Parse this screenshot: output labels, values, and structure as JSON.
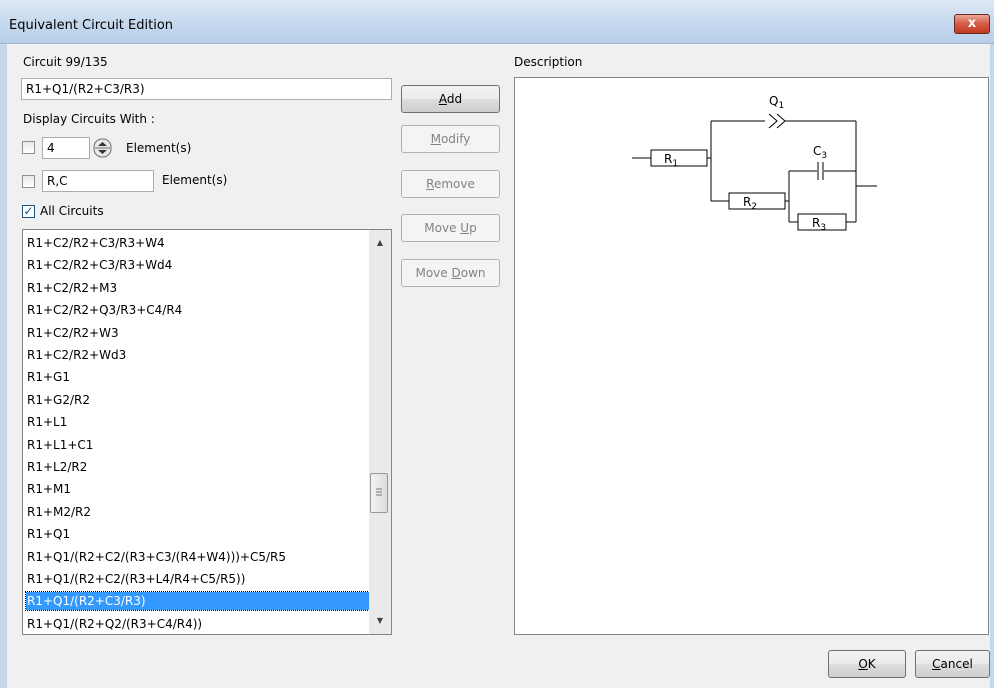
{
  "window": {
    "title": "Equivalent Circuit Edition",
    "close_label": "x"
  },
  "circuit": {
    "counter_label": "Circuit 99/135",
    "current_value": "R1+Q1/(R2+C3/R3)"
  },
  "filter": {
    "display_label": "Display Circuits With :",
    "count_value": "4",
    "count_suffix": "Element(s)",
    "elements_value": "R,C",
    "elements_suffix": "Element(s)",
    "all_circuits_label": "All Circuits",
    "count_checked": false,
    "elements_checked": false,
    "all_checked": true
  },
  "buttons": {
    "add": {
      "accel": "A",
      "rest": "dd"
    },
    "modify": {
      "accel": "M",
      "rest": "odify"
    },
    "remove": {
      "accel": "R",
      "rest": "emove"
    },
    "move_up": {
      "pre": "Move ",
      "accel": "U",
      "rest": "p"
    },
    "move_down": {
      "pre": "Move ",
      "accel": "D",
      "rest": "own"
    },
    "ok": {
      "accel": "O",
      "rest": "K"
    },
    "cancel": {
      "accel": "C",
      "rest": "ancel"
    }
  },
  "list": {
    "items": [
      "R1+C2/R2+C3/R3+W4",
      "R1+C2/R2+C3/R3+Wd4",
      "R1+C2/R2+M3",
      "R1+C2/R2+Q3/R3+C4/R4",
      "R1+C2/R2+W3",
      "R1+C2/R2+Wd3",
      "R1+G1",
      "R1+G2/R2",
      "R1+L1",
      "R1+L1+C1",
      "R1+L2/R2",
      "R1+M1",
      "R1+M2/R2",
      "R1+Q1",
      "R1+Q1/(R2+C2/(R3+C3/(R4+W4)))+C5/R5",
      "R1+Q1/(R2+C2/(R3+L4/R4+C5/R5))",
      "R1+Q1/(R2+C3/R3)",
      "R1+Q1/(R2+Q2/(R3+C4/R4))"
    ],
    "selected_index": 16,
    "scroll_fraction": 0.62
  },
  "description": {
    "label": "Description",
    "diagram": {
      "r1": "R",
      "r1_sub": "1",
      "r2": "R",
      "r2_sub": "2",
      "r3": "R",
      "r3_sub": "3",
      "c3": "C",
      "c3_sub": "3",
      "q1": "Q",
      "q1_sub": "1"
    }
  }
}
